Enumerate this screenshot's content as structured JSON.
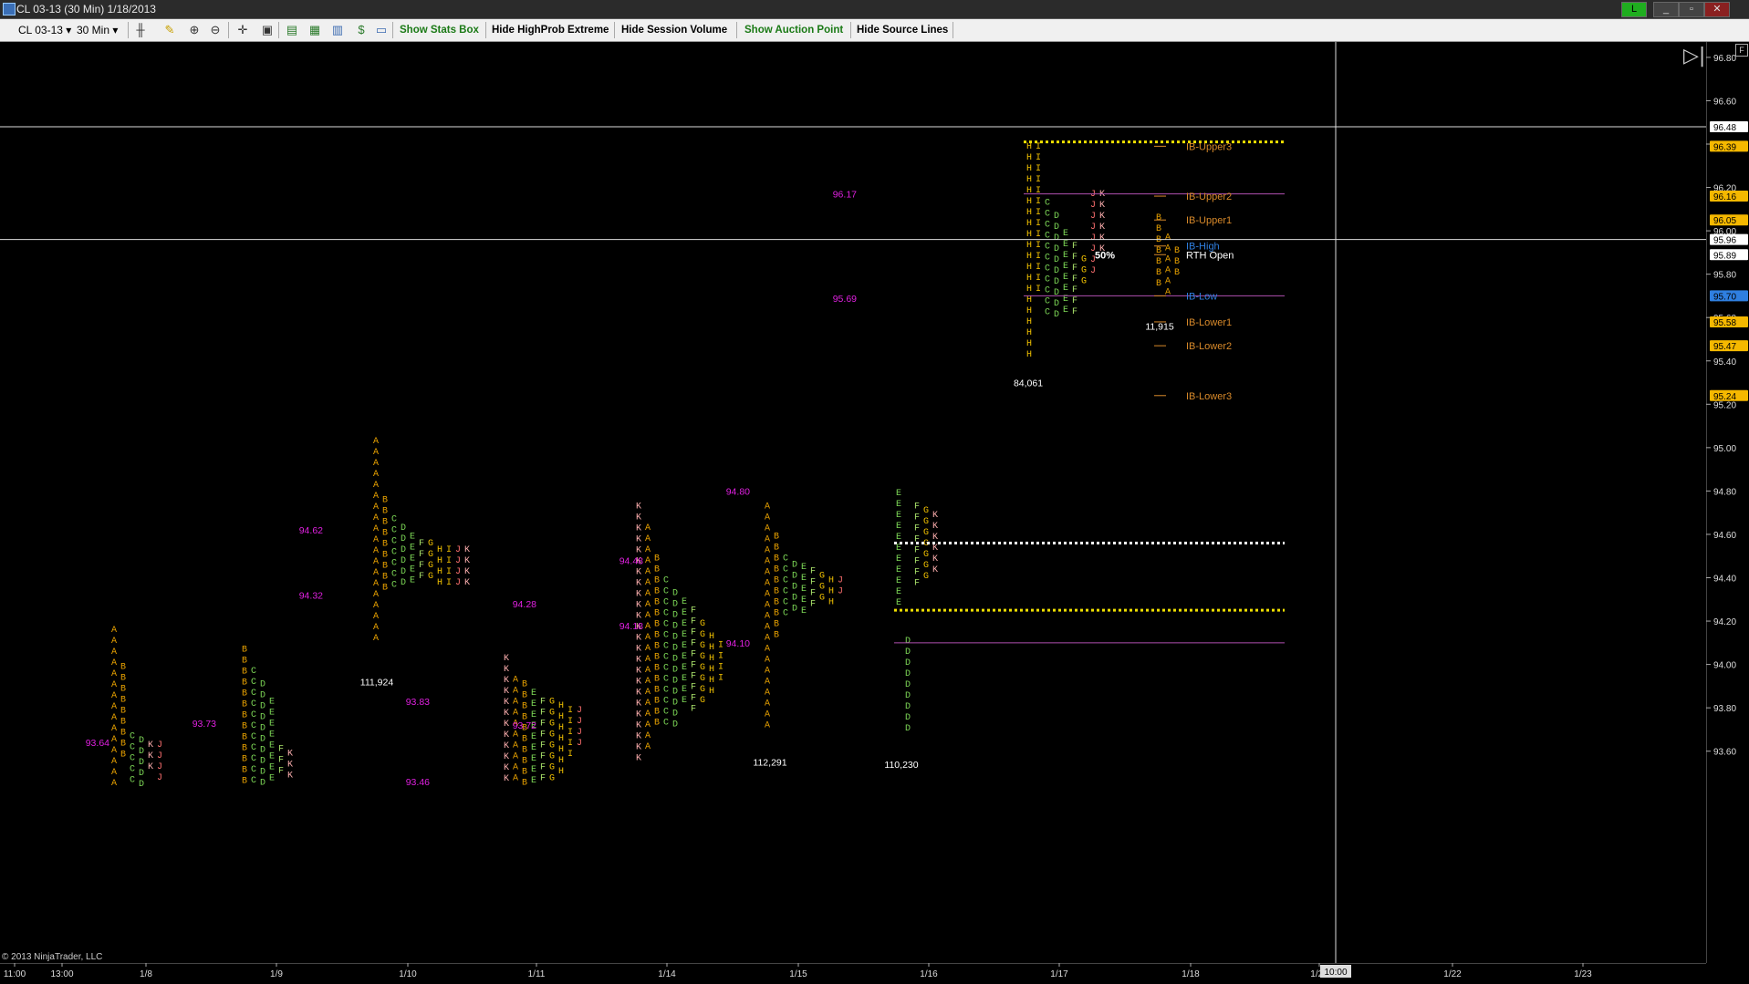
{
  "window": {
    "title": "CL 03-13 (30 Min)  1/18/2013",
    "buttons": [
      "L",
      "_",
      "▫",
      "✕"
    ]
  },
  "toolbar": {
    "instrument": "CL 03-13",
    "interval": "30 Min",
    "buttons": {
      "stats": "Show Stats Box",
      "highprob": "Hide HighProb Extreme",
      "session_volume": "Hide Session Volume",
      "auction_point": "Show Auction Point",
      "source_lines": "Hide Source Lines"
    }
  },
  "chart_data": {
    "type": "market-profile",
    "instrument": "CL 03-13",
    "timeframe": "30 Min",
    "ylim": [
      93.4,
      96.9
    ],
    "y_ticks": [
      93.6,
      93.8,
      94.0,
      94.2,
      94.4,
      94.6,
      94.8,
      95.0,
      95.2,
      95.4,
      95.6,
      95.8,
      96.0,
      96.2,
      96.4,
      96.6,
      96.8
    ],
    "x_ticks": [
      "11:00",
      "13:00",
      "1/8",
      "1/9",
      "1/10",
      "1/11",
      "1/14",
      "1/15",
      "1/16",
      "1/17",
      "1/18",
      "1/21",
      "1/22",
      "1/23"
    ],
    "cursor_time": "10:00",
    "price_markers": [
      {
        "value": "96.48",
        "color": "#ffffff"
      },
      {
        "value": "96.39",
        "color": "#f5b800"
      },
      {
        "value": "96.16",
        "color": "#f5b800"
      },
      {
        "value": "96.05",
        "color": "#f5b800"
      },
      {
        "value": "95.96",
        "color": "#ffffff"
      },
      {
        "value": "95.89",
        "color": "#ffffff"
      },
      {
        "value": "95.70",
        "color": "#2f7fe0"
      },
      {
        "value": "95.58",
        "color": "#f5b800"
      },
      {
        "value": "95.47",
        "color": "#f5b800"
      },
      {
        "value": "95.24",
        "color": "#f5b800"
      }
    ],
    "ib_levels": [
      {
        "label": "IB-Upper3",
        "price": 96.39,
        "color": "#d98a2a"
      },
      {
        "label": "IB-Upper2",
        "price": 96.16,
        "color": "#d98a2a"
      },
      {
        "label": "IB-Upper1",
        "price": 96.05,
        "color": "#d98a2a"
      },
      {
        "label": "IB-High",
        "price": 95.93,
        "color": "#2f7fe0"
      },
      {
        "label": "RTH Open",
        "price": 95.89,
        "color": "#ffffff"
      },
      {
        "label": "IB-Low",
        "price": 95.7,
        "color": "#2f7fe0"
      },
      {
        "label": "IB-Lower1",
        "price": 95.58,
        "color": "#d98a2a"
      },
      {
        "label": "IB-Lower2",
        "price": 95.47,
        "color": "#d98a2a"
      },
      {
        "label": "IB-Lower3",
        "price": 95.24,
        "color": "#d98a2a"
      }
    ],
    "value_area_labels": [
      {
        "value": "93.64",
        "price": 93.64,
        "x": 100
      },
      {
        "value": "93.73",
        "price": 93.73,
        "x": 217
      },
      {
        "value": "94.62",
        "price": 94.62,
        "x": 334
      },
      {
        "value": "94.32",
        "price": 94.32,
        "x": 334
      },
      {
        "value": "93.83",
        "price": 93.83,
        "x": 451
      },
      {
        "value": "93.46",
        "price": 93.46,
        "x": 451
      },
      {
        "value": "94.28",
        "price": 94.28,
        "x": 568
      },
      {
        "value": "93.72",
        "price": 93.72,
        "x": 568
      },
      {
        "value": "94.48",
        "price": 94.48,
        "x": 685
      },
      {
        "value": "94.18",
        "price": 94.18,
        "x": 685
      },
      {
        "value": "94.80",
        "price": 94.8,
        "x": 802
      },
      {
        "value": "94.10",
        "price": 94.1,
        "x": 802
      },
      {
        "value": "96.17",
        "price": 96.17,
        "x": 919
      },
      {
        "value": "95.69",
        "price": 95.69,
        "x": 919
      }
    ],
    "session_volumes": [
      {
        "value": "111,924",
        "price": 93.92
      },
      {
        "value": "112,291",
        "price": 93.55
      },
      {
        "value": "110,230",
        "price": 93.54
      },
      {
        "value": "84,061",
        "price": 95.3
      },
      {
        "value": "11,915",
        "price": 95.56
      }
    ],
    "percent_label": "50%",
    "copyright": "© 2013 NinjaTrader, LLC"
  }
}
